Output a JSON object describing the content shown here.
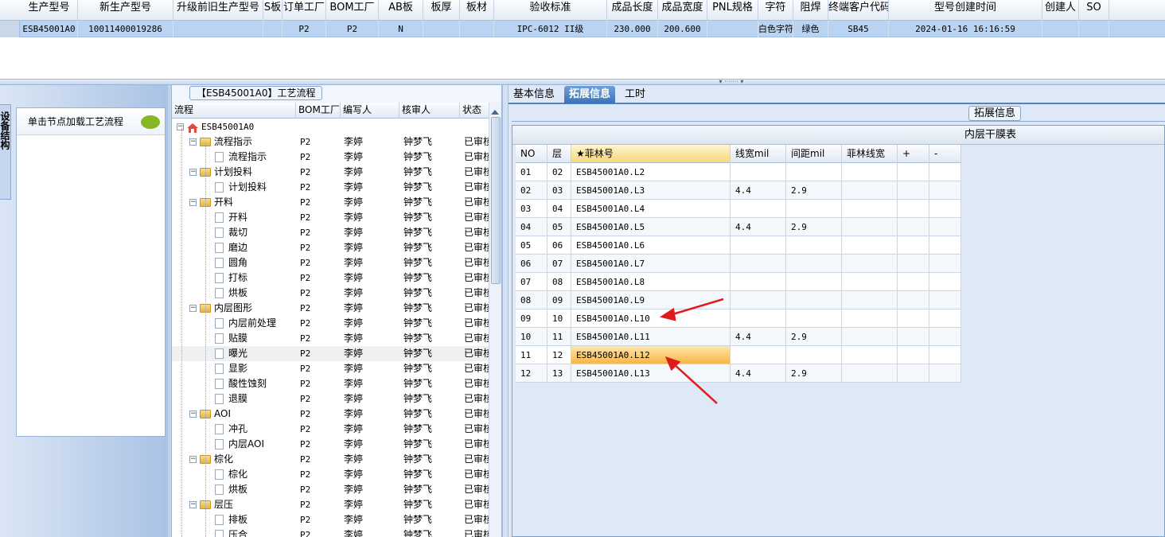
{
  "top_grid": {
    "headers": [
      "生产型号",
      "新生产型号",
      "升级前旧生产型号",
      "S板",
      "订单工厂",
      "BOM工厂",
      "AB板",
      "板厚",
      "板材",
      "验收标准",
      "成品长度",
      "成品宽度",
      "PNL规格",
      "字符",
      "阻焊",
      "终端客户代码",
      "型号创建时间",
      "创建人",
      "SO"
    ],
    "row": [
      "ESB45001A0",
      "10011400019286",
      "",
      "",
      "P2",
      "P2",
      "N",
      "",
      "",
      "IPC-6012 II级",
      "230.000",
      "200.600",
      "",
      "白色字符",
      "绿色",
      "SB45",
      "2024-01-16 16:16:59",
      "",
      ""
    ]
  },
  "left_panel": {
    "vertical_tab": "设备结构",
    "hint": "单击节点加载工艺流程"
  },
  "tree_panel": {
    "title": "【ESB45001A0】工艺流程",
    "headers": [
      "流程",
      "BOM工厂",
      "编写人",
      "核审人",
      "状态"
    ],
    "root": "ESB45001A0",
    "rows": [
      {
        "name": "流程指示",
        "level": 1,
        "type": "folder",
        "bom": "P2",
        "writer": "李婷",
        "reviewer": "钟梦飞",
        "status": "已审核"
      },
      {
        "name": "流程指示",
        "level": 2,
        "type": "doc",
        "bom": "P2",
        "writer": "李婷",
        "reviewer": "钟梦飞",
        "status": "已审核"
      },
      {
        "name": "计划投料",
        "level": 1,
        "type": "folder",
        "bom": "P2",
        "writer": "李婷",
        "reviewer": "钟梦飞",
        "status": "已审核"
      },
      {
        "name": "计划投料",
        "level": 2,
        "type": "doc",
        "bom": "P2",
        "writer": "李婷",
        "reviewer": "钟梦飞",
        "status": "已审核"
      },
      {
        "name": "开料",
        "level": 1,
        "type": "folder",
        "bom": "P2",
        "writer": "李婷",
        "reviewer": "钟梦飞",
        "status": "已审核"
      },
      {
        "name": "开料",
        "level": 2,
        "type": "doc",
        "bom": "P2",
        "writer": "李婷",
        "reviewer": "钟梦飞",
        "status": "已审核"
      },
      {
        "name": "裁切",
        "level": 2,
        "type": "doc",
        "bom": "P2",
        "writer": "李婷",
        "reviewer": "钟梦飞",
        "status": "已审核"
      },
      {
        "name": "磨边",
        "level": 2,
        "type": "doc",
        "bom": "P2",
        "writer": "李婷",
        "reviewer": "钟梦飞",
        "status": "已审核"
      },
      {
        "name": "圆角",
        "level": 2,
        "type": "doc",
        "bom": "P2",
        "writer": "李婷",
        "reviewer": "钟梦飞",
        "status": "已审核"
      },
      {
        "name": "打标",
        "level": 2,
        "type": "doc",
        "bom": "P2",
        "writer": "李婷",
        "reviewer": "钟梦飞",
        "status": "已审核"
      },
      {
        "name": "烘板",
        "level": 2,
        "type": "doc",
        "bom": "P2",
        "writer": "李婷",
        "reviewer": "钟梦飞",
        "status": "已审核"
      },
      {
        "name": "内层图形",
        "level": 1,
        "type": "folder",
        "bom": "P2",
        "writer": "李婷",
        "reviewer": "钟梦飞",
        "status": "已审核"
      },
      {
        "name": "内层前处理",
        "level": 2,
        "type": "doc",
        "bom": "P2",
        "writer": "李婷",
        "reviewer": "钟梦飞",
        "status": "已审核"
      },
      {
        "name": "贴膜",
        "level": 2,
        "type": "doc",
        "bom": "P2",
        "writer": "李婷",
        "reviewer": "钟梦飞",
        "status": "已审核"
      },
      {
        "name": "曝光",
        "level": 2,
        "type": "doc",
        "bom": "P2",
        "writer": "李婷",
        "reviewer": "钟梦飞",
        "status": "已审核",
        "selected": true
      },
      {
        "name": "显影",
        "level": 2,
        "type": "doc",
        "bom": "P2",
        "writer": "李婷",
        "reviewer": "钟梦飞",
        "status": "已审核"
      },
      {
        "name": "酸性蚀刻",
        "level": 2,
        "type": "doc",
        "bom": "P2",
        "writer": "李婷",
        "reviewer": "钟梦飞",
        "status": "已审核"
      },
      {
        "name": "退膜",
        "level": 2,
        "type": "doc",
        "bom": "P2",
        "writer": "李婷",
        "reviewer": "钟梦飞",
        "status": "已审核"
      },
      {
        "name": "AOI",
        "level": 1,
        "type": "folder",
        "bom": "P2",
        "writer": "李婷",
        "reviewer": "钟梦飞",
        "status": "已审核"
      },
      {
        "name": "冲孔",
        "level": 2,
        "type": "doc",
        "bom": "P2",
        "writer": "李婷",
        "reviewer": "钟梦飞",
        "status": "已审核"
      },
      {
        "name": "内层AOI",
        "level": 2,
        "type": "doc",
        "bom": "P2",
        "writer": "李婷",
        "reviewer": "钟梦飞",
        "status": "已审核"
      },
      {
        "name": "棕化",
        "level": 1,
        "type": "folder",
        "bom": "P2",
        "writer": "李婷",
        "reviewer": "钟梦飞",
        "status": "已审核"
      },
      {
        "name": "棕化",
        "level": 2,
        "type": "doc",
        "bom": "P2",
        "writer": "李婷",
        "reviewer": "钟梦飞",
        "status": "已审核"
      },
      {
        "name": "烘板",
        "level": 2,
        "type": "doc",
        "bom": "P2",
        "writer": "李婷",
        "reviewer": "钟梦飞",
        "status": "已审核"
      },
      {
        "name": "层压",
        "level": 1,
        "type": "folder",
        "bom": "P2",
        "writer": "李婷",
        "reviewer": "钟梦飞",
        "status": "已审核"
      },
      {
        "name": "排板",
        "level": 2,
        "type": "doc",
        "bom": "P2",
        "writer": "李婷",
        "reviewer": "钟梦飞",
        "status": "已审核"
      },
      {
        "name": "压合",
        "level": 2,
        "type": "doc",
        "bom": "P2",
        "writer": "李婷",
        "reviewer": "钟梦飞",
        "status": "已审核"
      }
    ]
  },
  "right_panel": {
    "tabs": [
      "基本信息",
      "拓展信息",
      "工时"
    ],
    "active_tab": 1,
    "group_label": "拓展信息",
    "table_title": "内层干膜表",
    "headers": [
      "NO",
      "层",
      "★菲林号",
      "线宽mil",
      "间距mil",
      "菲林线宽",
      "+",
      "-"
    ],
    "rows": [
      [
        "01",
        "02",
        "ESB45001A0.L2",
        "",
        "",
        ""
      ],
      [
        "02",
        "03",
        "ESB45001A0.L3",
        "4.4",
        "2.9",
        ""
      ],
      [
        "03",
        "04",
        "ESB45001A0.L4",
        "",
        "",
        ""
      ],
      [
        "04",
        "05",
        "ESB45001A0.L5",
        "4.4",
        "2.9",
        ""
      ],
      [
        "05",
        "06",
        "ESB45001A0.L6",
        "",
        "",
        ""
      ],
      [
        "06",
        "07",
        "ESB45001A0.L7",
        "",
        "",
        ""
      ],
      [
        "07",
        "08",
        "ESB45001A0.L8",
        "",
        "",
        ""
      ],
      [
        "08",
        "09",
        "ESB45001A0.L9",
        "",
        "",
        ""
      ],
      [
        "09",
        "10",
        "ESB45001A0.L10",
        "",
        "",
        ""
      ],
      [
        "10",
        "11",
        "ESB45001A0.L11",
        "4.4",
        "2.9",
        ""
      ],
      [
        "11",
        "12",
        "ESB45001A0.L12",
        "",
        "",
        ""
      ],
      [
        "12",
        "13",
        "ESB45001A0.L13",
        "4.4",
        "2.9",
        ""
      ]
    ],
    "highlighted_row": 10
  },
  "colors": {
    "accent": "#4f84c4",
    "annotation_arrow": "#e01b1b",
    "highlight": "#f7b54a"
  }
}
